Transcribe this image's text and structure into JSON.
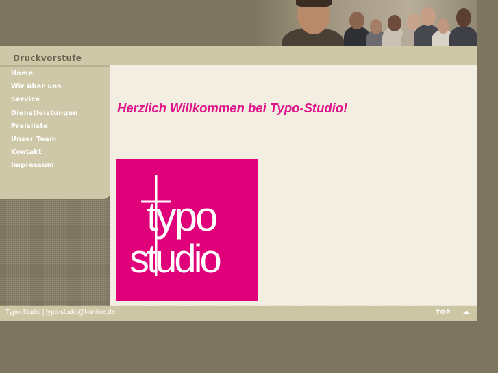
{
  "header": {
    "section_title": "Druckvorstufe"
  },
  "nav": {
    "items": [
      {
        "label": "Home"
      },
      {
        "label": "Wir über uns"
      },
      {
        "label": "Service"
      },
      {
        "label": "Dienstleistungen"
      },
      {
        "label": "Preisliste"
      },
      {
        "label": "Unser Team"
      },
      {
        "label": "Kontakt"
      },
      {
        "label": "Impressum"
      }
    ]
  },
  "main": {
    "welcome": "Herzlich Willkommen bei Typo-Studio!",
    "logo": {
      "line1": "typo",
      "line2": "studio",
      "bg_color": "#e0007a"
    }
  },
  "footer": {
    "text": "Typo-Studio | typo-studio@t-online.de",
    "top_label": "TOP"
  },
  "colors": {
    "accent": "#e0138a",
    "background": "#7d7560",
    "panel": "#cfc8a8",
    "content_bg": "#f2efe2"
  }
}
